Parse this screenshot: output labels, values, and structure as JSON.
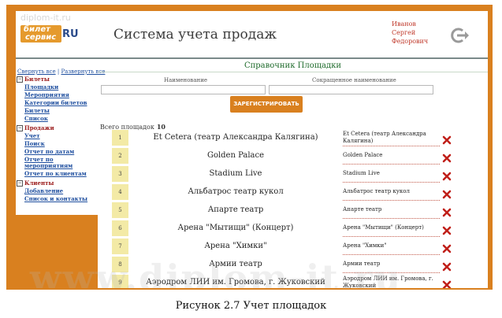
{
  "watermark_top": "diplom-it.ru",
  "watermark_bottom": "www.diplom-it.ru",
  "logo": {
    "line1": "билет",
    "line2": "сервис",
    "suffix": "RU"
  },
  "app_title": "Система учета продаж",
  "user": {
    "last_name": "Иванов",
    "first_name": "Сергей",
    "patronymic": "Федорович"
  },
  "sidebar": {
    "collapse_all": "Свернуть все",
    "separator": "|",
    "expand_all": "Развернуть все",
    "groups": [
      {
        "toggle": "−",
        "label": "Билеты",
        "items": [
          "Площадки",
          "Мероприятия",
          "Категории билетов",
          "Билеты",
          "Список"
        ]
      },
      {
        "toggle": "−",
        "label": "Продажи",
        "items": [
          "Учет",
          "Поиск",
          "Отчет по датам",
          "Отчет по мероприятиям",
          "Отчет по клиентам"
        ]
      },
      {
        "toggle": "−",
        "label": "Клиенты",
        "items": [
          "Добавление",
          "Список и контакты"
        ]
      }
    ]
  },
  "main": {
    "title": "Справочник Площадки",
    "form": {
      "name_label": "Наименование",
      "short_label": "Сокращенное наименование",
      "name_value": "",
      "short_value": "",
      "register_button": "ЗАРЕГИСТРИРОВАТЬ"
    },
    "total_label": "Всего площадок",
    "total_count": "10",
    "rows": [
      {
        "num": "1",
        "name": "Et Cetera (театр Александра Калягина)",
        "short": "Et Cetera (театр Александра Калягина)"
      },
      {
        "num": "2",
        "name": "Golden Palace",
        "short": "Golden Palace"
      },
      {
        "num": "3",
        "name": "Stadium Live",
        "short": "Stadium Live"
      },
      {
        "num": "4",
        "name": "Альбатрос театр кукол",
        "short": "Альбатрос театр кукол"
      },
      {
        "num": "5",
        "name": "Апарте театр",
        "short": "Апарте театр"
      },
      {
        "num": "6",
        "name": "Арена \"Мытищи\" (Концерт)",
        "short": "Арена \"Мытищи\" (Концерт)"
      },
      {
        "num": "7",
        "name": "Арена \"Химки\"",
        "short": "Арена \"Химки\""
      },
      {
        "num": "8",
        "name": "Армии театр",
        "short": "Армии театр"
      },
      {
        "num": "9",
        "name": "Аэродром ЛИИ им. Громова, г. Жуковский",
        "short": "Аэродром ЛИИ им. Громова, г. Жуковский"
      }
    ]
  },
  "caption": "Рисунок 2.7 Учет площадок",
  "colors": {
    "accent": "#d9801f",
    "title_green": "#1d6a2a",
    "user_red": "#c0392b",
    "link_blue": "#1f4f9f",
    "delete_red": "#c0201a"
  },
  "icons": {
    "logout": "logout-icon",
    "delete": "delete-x-icon",
    "toggle": "minus-box-icon"
  }
}
